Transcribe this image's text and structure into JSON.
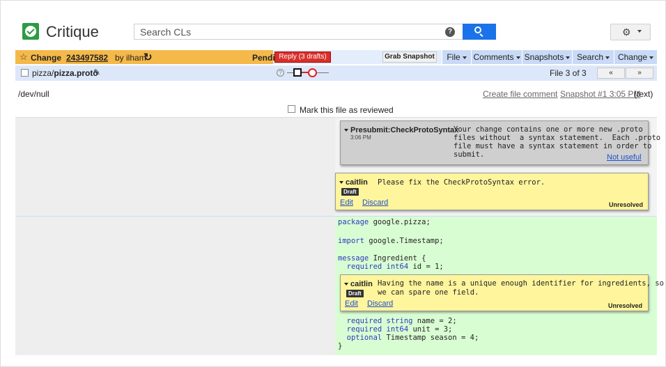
{
  "header": {
    "app_name": "Critique",
    "search": {
      "placeholder": "Search CLs",
      "value": ""
    },
    "help_icon": "help-circle-icon",
    "search_icon": "magnifier-icon",
    "settings_icon": "gear-icon"
  },
  "change_bar": {
    "label": "Change",
    "change_number": "243497582",
    "by": "by ilham",
    "status": "Pending",
    "reply_button": "Reply (3 drafts)",
    "grab_snapshot_button": "Grab Snapshot",
    "menus": [
      "File",
      "Comments",
      "Snapshots",
      "Search",
      "Change"
    ]
  },
  "file_bar": {
    "dir": "pizza/",
    "file": "pizza.proto",
    "file_count": "File 3 of 3",
    "prev_button": "«",
    "next_button": "»"
  },
  "path_row": {
    "left_path": "/dev/null",
    "create_comment": "Create file comment",
    "snapshot_link": "Snapshot #1 3:05 PM",
    "snapshot_type": "(text)",
    "mark_reviewed": "Mark this file as reviewed"
  },
  "comments": [
    {
      "author": "Presubmit:CheckProtoSyntax",
      "time": "3:06 PM",
      "body": "Your change contains one or more new .proto\nfiles without  a syntax statement.  Each .proto\nfile must have a syntax statement in order to\nsubmit.",
      "action": "Not useful"
    },
    {
      "author": "caitlin",
      "badge": "Draft",
      "body": "Please fix the CheckProtoSyntax error.",
      "edit": "Edit",
      "discard": "Discard",
      "status": "Unresolved"
    },
    {
      "author": "caitlin",
      "badge": "Draft",
      "body": "Having the name is a unique enough identifier for ingredients, so\nwe can spare one field.",
      "edit": "Edit",
      "discard": "Discard",
      "status": "Unresolved"
    }
  ],
  "code": {
    "line1_kw": "package",
    "line1_rest": " google.pizza;",
    "line2_kw": "import",
    "line2_rest": " google.Timestamp;",
    "line3_kw": "message",
    "line3_rest": " Ingredient {",
    "line4_kw": "  required int64",
    "line4_rest": " id = 1;",
    "line5_kw": "  required string",
    "line5_rest": " name = 2;",
    "line6_kw": "  required int64",
    "line6_rest": " unit = 3;",
    "line7_kw": "  optional",
    "line7_rest": " Timestamp season = 4;",
    "line8": "}"
  },
  "colors": {
    "change_bar_orange": "#f5b94a",
    "reply_red": "#d9302a",
    "search_blue": "#1a73e8",
    "added_green": "#d9fdd3",
    "draft_yellow": "#fff59d"
  }
}
